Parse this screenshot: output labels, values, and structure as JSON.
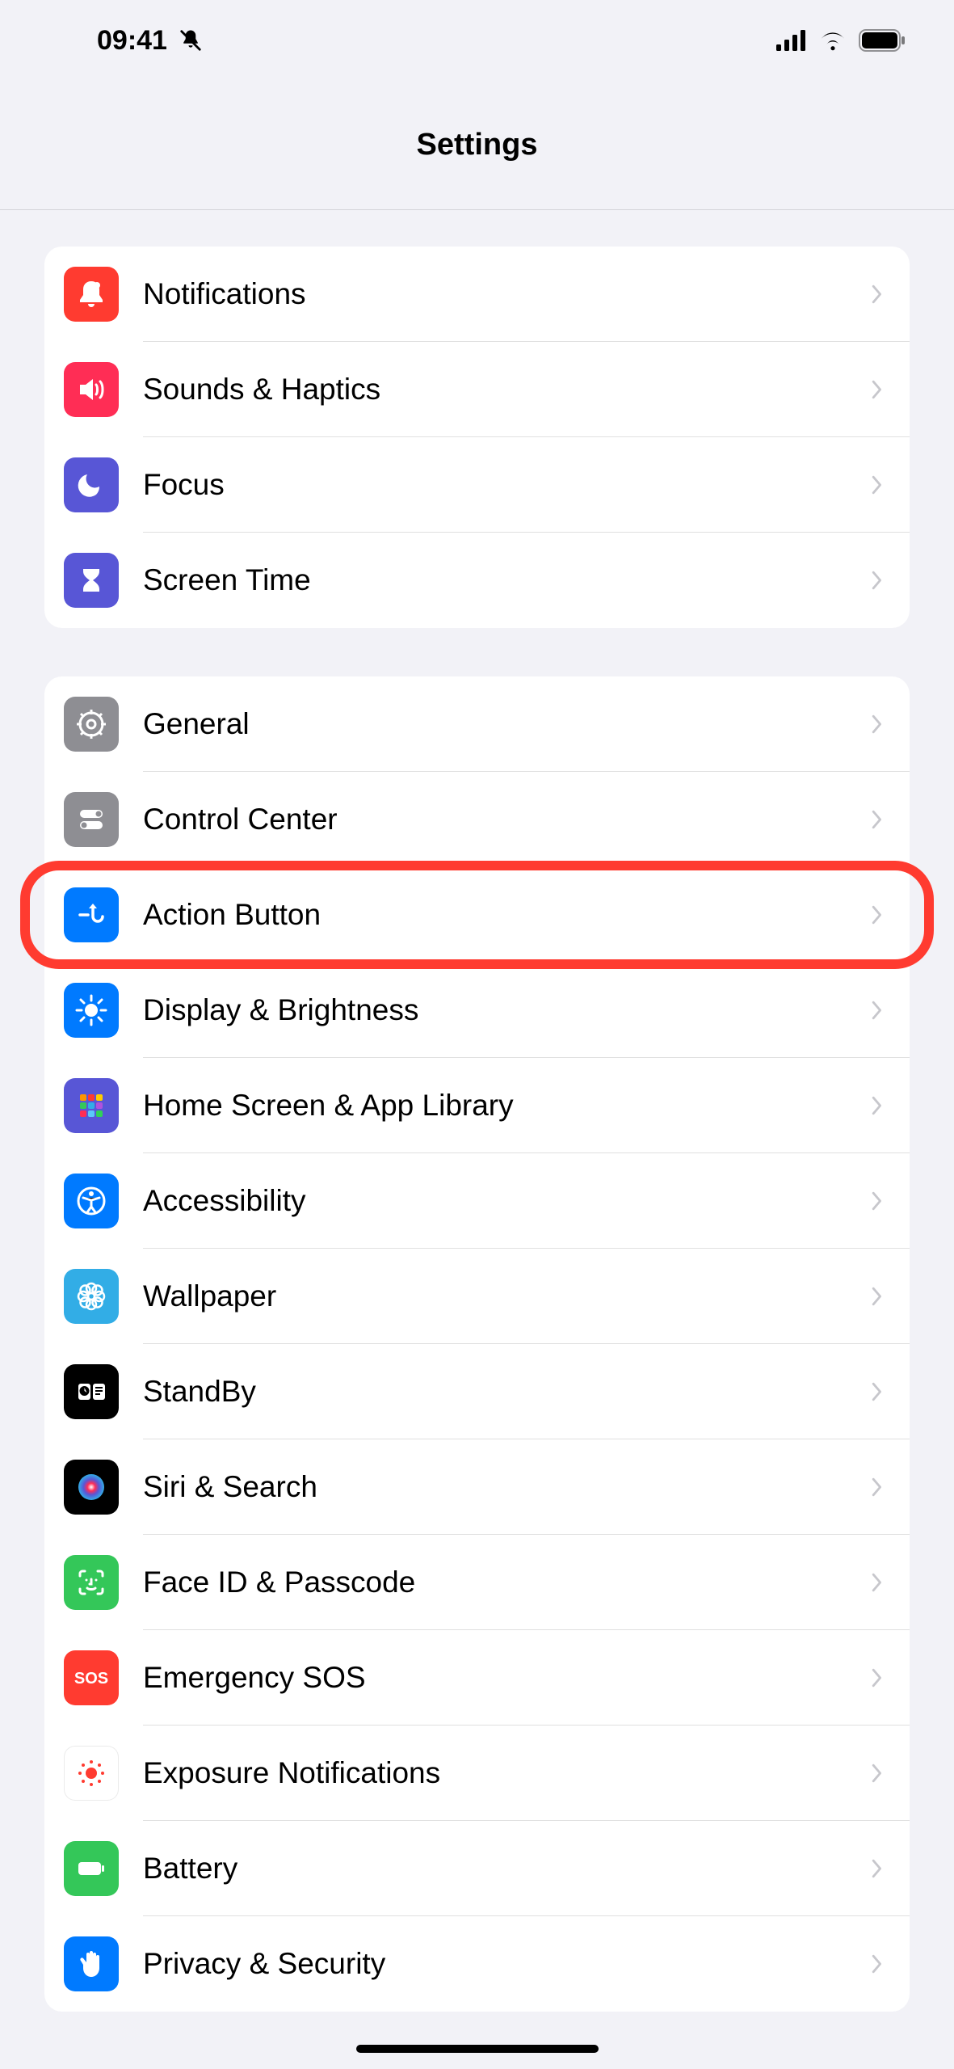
{
  "status": {
    "time": "09:41"
  },
  "header": {
    "title": "Settings"
  },
  "groups": [
    {
      "items": [
        {
          "key": "notifications",
          "label": "Notifications",
          "icon": "bell-icon",
          "bg": "bg-red"
        },
        {
          "key": "sounds",
          "label": "Sounds & Haptics",
          "icon": "speaker-icon",
          "bg": "bg-pink"
        },
        {
          "key": "focus",
          "label": "Focus",
          "icon": "moon-icon",
          "bg": "bg-indigo"
        },
        {
          "key": "screentime",
          "label": "Screen Time",
          "icon": "hourglass-icon",
          "bg": "bg-indigo"
        }
      ]
    },
    {
      "items": [
        {
          "key": "general",
          "label": "General",
          "icon": "gear-icon",
          "bg": "bg-gray"
        },
        {
          "key": "controlcenter",
          "label": "Control Center",
          "icon": "switches-icon",
          "bg": "bg-gray"
        },
        {
          "key": "actionbutton",
          "label": "Action Button",
          "icon": "action-button-icon",
          "bg": "bg-blue",
          "highlighted": true
        },
        {
          "key": "display",
          "label": "Display & Brightness",
          "icon": "sun-icon",
          "bg": "bg-blue"
        },
        {
          "key": "homescreen",
          "label": "Home Screen & App Library",
          "icon": "apps-grid-icon",
          "bg": "bg-apps"
        },
        {
          "key": "accessibility",
          "label": "Accessibility",
          "icon": "accessibility-icon",
          "bg": "bg-blue"
        },
        {
          "key": "wallpaper",
          "label": "Wallpaper",
          "icon": "flower-icon",
          "bg": "bg-cyan"
        },
        {
          "key": "standby",
          "label": "StandBy",
          "icon": "standby-icon",
          "bg": "bg-black"
        },
        {
          "key": "siri",
          "label": "Siri & Search",
          "icon": "siri-icon",
          "bg": "bg-siri"
        },
        {
          "key": "faceid",
          "label": "Face ID & Passcode",
          "icon": "faceid-icon",
          "bg": "bg-green"
        },
        {
          "key": "sos",
          "label": "Emergency SOS",
          "icon": "sos-icon",
          "bg": "bg-red"
        },
        {
          "key": "exposure",
          "label": "Exposure Notifications",
          "icon": "exposure-icon",
          "bg": "bg-white-bordered"
        },
        {
          "key": "battery",
          "label": "Battery",
          "icon": "battery-icon",
          "bg": "bg-green"
        },
        {
          "key": "privacy",
          "label": "Privacy & Security",
          "icon": "hand-icon",
          "bg": "bg-blue"
        }
      ]
    }
  ]
}
